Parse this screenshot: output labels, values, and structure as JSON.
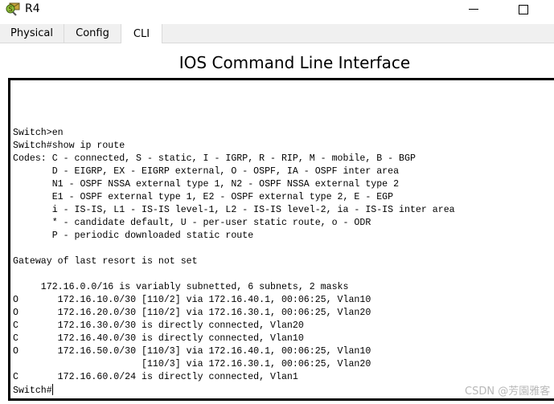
{
  "window": {
    "title": "R4",
    "icon": "router-device-icon",
    "controls": {
      "minimize": "minimize-icon",
      "maximize": "maximize-icon"
    }
  },
  "tabs": [
    {
      "label": "Physical",
      "active": false
    },
    {
      "label": "Config",
      "active": false
    },
    {
      "label": "CLI",
      "active": true
    }
  ],
  "heading": "IOS Command Line Interface",
  "terminal": {
    "lines": [
      "Switch>en",
      "Switch#show ip route",
      "Codes: C - connected, S - static, I - IGRP, R - RIP, M - mobile, B - BGP",
      "       D - EIGRP, EX - EIGRP external, O - OSPF, IA - OSPF inter area",
      "       N1 - OSPF NSSA external type 1, N2 - OSPF NSSA external type 2",
      "       E1 - OSPF external type 1, E2 - OSPF external type 2, E - EGP",
      "       i - IS-IS, L1 - IS-IS level-1, L2 - IS-IS level-2, ia - IS-IS inter area",
      "       * - candidate default, U - per-user static route, o - ODR",
      "       P - periodic downloaded static route",
      "",
      "Gateway of last resort is not set",
      "",
      "     172.16.0.0/16 is variably subnetted, 6 subnets, 2 masks",
      "O       172.16.10.0/30 [110/2] via 172.16.40.1, 00:06:25, Vlan10",
      "O       172.16.20.0/30 [110/2] via 172.16.30.1, 00:06:25, Vlan20",
      "C       172.16.30.0/30 is directly connected, Vlan20",
      "C       172.16.40.0/30 is directly connected, Vlan10",
      "O       172.16.50.0/30 [110/3] via 172.16.40.1, 00:06:25, Vlan10",
      "                       [110/3] via 172.16.30.1, 00:06:25, Vlan20",
      "C       172.16.60.0/24 is directly connected, Vlan1"
    ],
    "prompt": "Switch#"
  },
  "watermark": "CSDN @芳園雅客"
}
